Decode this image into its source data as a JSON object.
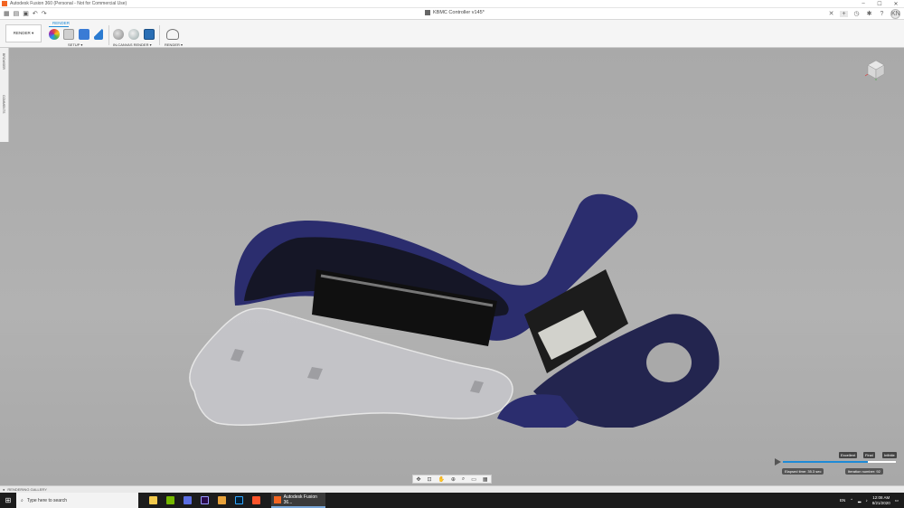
{
  "window": {
    "title": "Autodesk Fusion 360 (Personal - Not for Commercial Use)",
    "controls": [
      "–",
      "☐",
      "✕"
    ]
  },
  "document": {
    "tab_title": "KBMC Controller v145*",
    "user_initials": "KN"
  },
  "toolbar": {
    "workspace_label": "RENDER ▾",
    "active_tab": "RENDER",
    "groups": {
      "setup": "SETUP ▾",
      "in_canvas_render": "IN-CANVAS RENDER ▾",
      "render": "RENDER ▾"
    }
  },
  "browser_strip": {
    "browser_label": "BROWSER",
    "comments_label": "COMMENTS"
  },
  "render_controls": {
    "progress": 0.75,
    "quality_levels": [
      "Excellent",
      "Final",
      "Infinite"
    ],
    "elapsed_time": "Elapsed time: 35.3 sec",
    "iteration": "Iteration number: 92"
  },
  "gallery": {
    "label": "RENDERING GALLERY"
  },
  "taskbar": {
    "search_placeholder": "Type here to search",
    "active_app": "Autodesk Fusion 36...",
    "language": "EN",
    "time": "12:08 AM",
    "date": "8/21/2020"
  },
  "colors": {
    "accent": "#1e8ad6",
    "shell": "#2b2d6e",
    "background": "#aaaaaa"
  }
}
